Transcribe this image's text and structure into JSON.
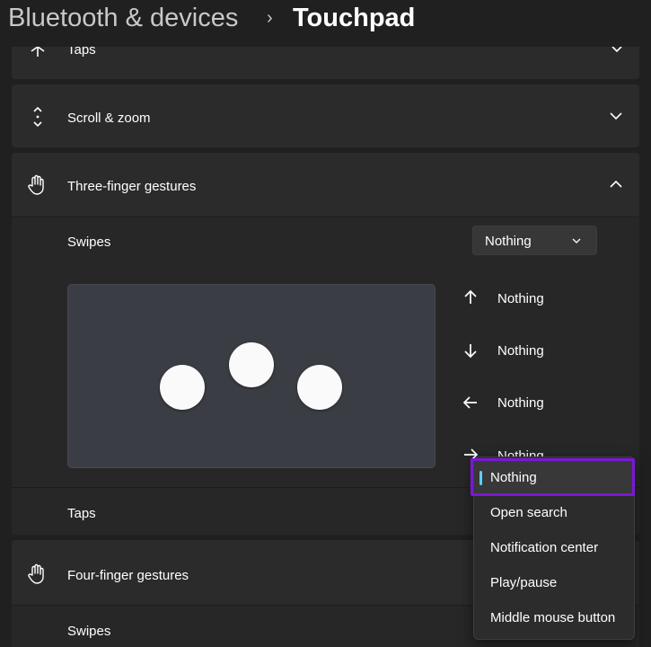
{
  "header": {
    "breadcrumb_parent": "Bluetooth & devices",
    "separator": "›",
    "title": "Touchpad"
  },
  "sections": {
    "taps_top": {
      "label": "Taps"
    },
    "scroll_zoom": {
      "label": "Scroll & zoom"
    },
    "three_finger": {
      "label": "Three-finger gestures",
      "swipes_label": "Swipes",
      "swipes_value": "Nothing",
      "directions": {
        "up": "Nothing",
        "down": "Nothing",
        "left": "Nothing",
        "right": "Nothing"
      },
      "taps_label": "Taps"
    },
    "four_finger": {
      "label": "Four-finger gestures",
      "swipes_label": "Swipes"
    }
  },
  "dropdown_menu": {
    "options": [
      "Nothing",
      "Open search",
      "Notification center",
      "Play/pause",
      "Middle mouse button"
    ],
    "selected": "Nothing"
  },
  "colors": {
    "accent": "#60cdff",
    "highlight_box": "#7b17d8"
  }
}
